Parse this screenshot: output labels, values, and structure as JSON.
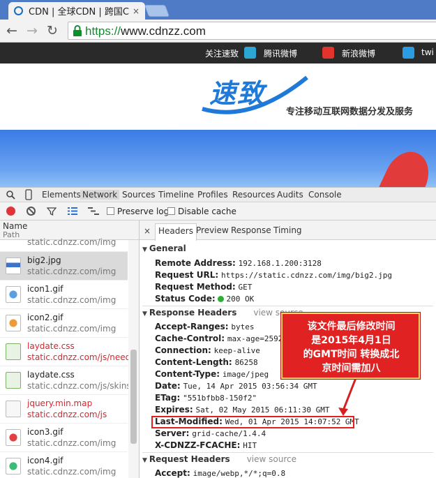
{
  "browser": {
    "tab_title": "CDN | 全球CDN | 跨国CD",
    "tab_close": "×",
    "back": "←",
    "forward": "→",
    "reload": "↻",
    "url_https": "https://",
    "url_rest": "www.cdnzz.com"
  },
  "site": {
    "follow": "关注速致",
    "links": [
      {
        "label": "腾讯微博",
        "icon": "tencent-weibo-icon",
        "color": "#2ea6d4"
      },
      {
        "label": "新浪微博",
        "icon": "sina-weibo-icon",
        "color": "#e2342c"
      },
      {
        "label": "twi",
        "icon": "twitter-icon",
        "color": "#2b9be3"
      }
    ],
    "logo": "速致",
    "slogan": "专注移动互联网数据分发及服务"
  },
  "devtools": {
    "tabs": [
      "Elements",
      "Network",
      "Sources",
      "Timeline",
      "Profiles",
      "Resources",
      "Audits",
      "Console"
    ],
    "active_tab": "Network",
    "preserve_log": "Preserve log",
    "disable_cache": "Disable cache",
    "list_header": {
      "name": "Name",
      "path": "Path"
    },
    "files": [
      {
        "name": "",
        "path": "static.cdnzz.com/img",
        "status": "ok",
        "icon": "image-icon"
      },
      {
        "name": "big2.jpg",
        "path": "static.cdnzz.com/img",
        "status": "ok",
        "icon": "image-icon",
        "selected": true
      },
      {
        "name": "icon1.gif",
        "path": "static.cdnzz.com/img",
        "status": "ok",
        "icon": "gif-icon"
      },
      {
        "name": "icon2.gif",
        "path": "static.cdnzz.com/img",
        "status": "ok",
        "icon": "gif-icon"
      },
      {
        "name": "laydate.css",
        "path": "static.cdnzz.com/js/need",
        "status": "error",
        "icon": "css-icon"
      },
      {
        "name": "laydate.css",
        "path": "static.cdnzz.com/js/skins...",
        "status": "ok",
        "icon": "css-icon"
      },
      {
        "name": "jquery.min.map",
        "path": "static.cdnzz.com/js",
        "status": "error",
        "icon": "file-icon"
      },
      {
        "name": "icon3.gif",
        "path": "static.cdnzz.com/img",
        "status": "ok",
        "icon": "gif-icon"
      },
      {
        "name": "icon4.gif",
        "path": "static.cdnzz.com/img",
        "status": "ok",
        "icon": "gif-icon"
      }
    ],
    "detail_tabs": [
      "Headers",
      "Preview",
      "Response",
      "Timing"
    ],
    "detail_close": "×",
    "general": {
      "title": "General",
      "rows": [
        {
          "k": "Remote Address:",
          "v": "192.168.1.200:3128"
        },
        {
          "k": "Request URL:",
          "v": "https://static.cdnzz.com/img/big2.jpg"
        },
        {
          "k": "Request Method:",
          "v": "GET"
        },
        {
          "k": "Status Code:",
          "v": "200 OK"
        }
      ]
    },
    "response_headers": {
      "title": "Response Headers",
      "view_source": "view source",
      "rows": [
        {
          "k": "Accept-Ranges:",
          "v": "bytes"
        },
        {
          "k": "Cache-Control:",
          "v": "max-age=259200"
        },
        {
          "k": "Connection:",
          "v": "keep-alive"
        },
        {
          "k": "Content-Length:",
          "v": "86258"
        },
        {
          "k": "Content-Type:",
          "v": "image/jpeg"
        },
        {
          "k": "Date:",
          "v": "Tue, 14 Apr 2015 03:56:34 GMT"
        },
        {
          "k": "ETag:",
          "v": "\"551bfbb8-150f2\""
        },
        {
          "k": "Expires:",
          "v": "Sat, 02 May 2015 06:11:30 GMT"
        },
        {
          "k": "Last-Modified:",
          "v": "Wed, 01 Apr 2015 14:07:52 GMT"
        },
        {
          "k": "Server:",
          "v": "grid-cache/1.4.4"
        },
        {
          "k": "X-CDNZZ-FCACHE:",
          "v": "HIT"
        }
      ]
    },
    "request_headers": {
      "title": "Request Headers",
      "view_source": "view source",
      "rows": [
        {
          "k": "Accept:",
          "v": "image/webp,*/*;q=0.8"
        }
      ]
    }
  },
  "annotation": {
    "lines": [
      "该文件最后修改时间",
      "是2015年4月1日",
      "的GMT时间 转换成北",
      "京时间需加八"
    ]
  }
}
